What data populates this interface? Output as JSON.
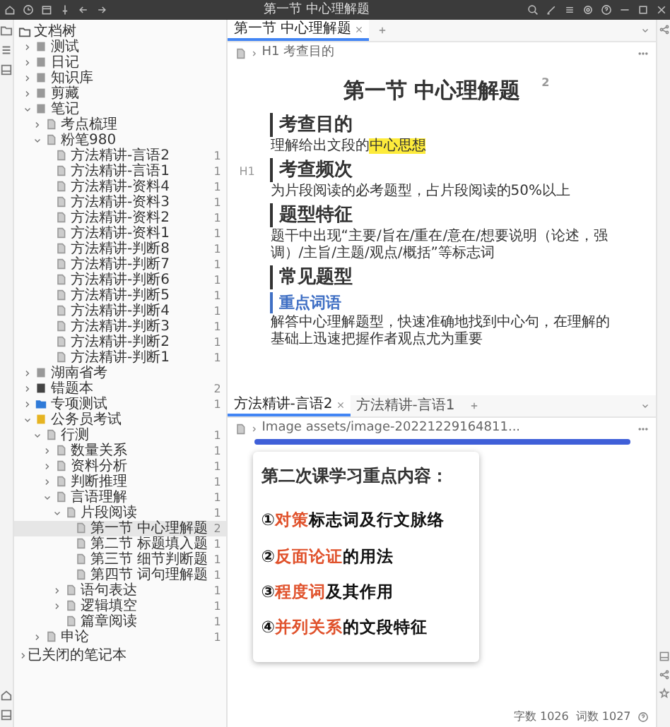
{
  "titlebar": {
    "title": "第一节 中心理解题"
  },
  "filetree": {
    "title": "文档树",
    "items": [
      {
        "name": "测试",
        "kind": "notebook",
        "expanded": false,
        "selected": false
      },
      {
        "name": "日记",
        "kind": "notebook",
        "expanded": false,
        "selected": false
      },
      {
        "name": "知识库",
        "kind": "notebook",
        "expanded": false,
        "selected": false
      },
      {
        "name": "剪藏",
        "kind": "notebook",
        "expanded": false,
        "selected": false
      },
      {
        "name": "笔记",
        "kind": "notebook",
        "expanded": true,
        "selected": false,
        "children": [
          {
            "name": "考点梳理",
            "kind": "doc",
            "expanded": false,
            "selected": false
          },
          {
            "name": "粉笔980",
            "kind": "doc",
            "expanded": true,
            "selected": false,
            "children": [
              {
                "name": "方法精讲-言语2",
                "kind": "doc",
                "count": "1",
                "selected": false
              },
              {
                "name": "方法精讲-言语1",
                "kind": "doc",
                "count": "1",
                "selected": false
              },
              {
                "name": "方法精讲-资料4",
                "kind": "doc",
                "count": "1",
                "selected": false
              },
              {
                "name": "方法精讲-资料3",
                "kind": "doc",
                "count": "1",
                "selected": false
              },
              {
                "name": "方法精讲-资料2",
                "kind": "doc",
                "count": "1",
                "selected": false
              },
              {
                "name": "方法精讲-资料1",
                "kind": "doc",
                "count": "1",
                "selected": false
              },
              {
                "name": "方法精讲-判断8",
                "kind": "doc",
                "count": "1",
                "selected": false
              },
              {
                "name": "方法精讲-判断7",
                "kind": "doc",
                "count": "1",
                "selected": false
              },
              {
                "name": "方法精讲-判断6",
                "kind": "doc",
                "count": "1",
                "selected": false
              },
              {
                "name": "方法精讲-判断5",
                "kind": "doc",
                "count": "1",
                "selected": false
              },
              {
                "name": "方法精讲-判断4",
                "kind": "doc",
                "count": "1",
                "selected": false
              },
              {
                "name": "方法精讲-判断3",
                "kind": "doc",
                "count": "1",
                "selected": false
              },
              {
                "name": "方法精讲-判断2",
                "kind": "doc",
                "count": "1",
                "selected": false
              },
              {
                "name": "方法精讲-判断1",
                "kind": "doc",
                "count": "1",
                "selected": false
              }
            ]
          }
        ]
      },
      {
        "name": "湖南省考",
        "kind": "notebook",
        "expanded": false,
        "selected": false
      },
      {
        "name": "错题本",
        "kind": "book",
        "expanded": false,
        "count": "2",
        "selected": false
      },
      {
        "name": "专项测试",
        "kind": "folder",
        "expanded": false,
        "count": "1",
        "selected": false
      },
      {
        "name": "公务员考试",
        "kind": "journal",
        "expanded": true,
        "selected": false,
        "children": [
          {
            "name": "行测",
            "kind": "doc",
            "expanded": true,
            "count": "1",
            "selected": false,
            "children": [
              {
                "name": "数量关系",
                "kind": "doc",
                "expanded": false,
                "count": "1",
                "selected": false
              },
              {
                "name": "资料分析",
                "kind": "doc",
                "expanded": false,
                "count": "1",
                "selected": false
              },
              {
                "name": "判断推理",
                "kind": "doc",
                "expanded": false,
                "count": "1",
                "selected": false
              },
              {
                "name": "言语理解",
                "kind": "doc",
                "expanded": true,
                "count": "1",
                "selected": false,
                "children": [
                  {
                    "name": "片段阅读",
                    "kind": "doc",
                    "expanded": true,
                    "count": "1",
                    "selected": false,
                    "children": [
                      {
                        "name": "第一节 中心理解题",
                        "kind": "doc",
                        "count": "2",
                        "selected": true
                      },
                      {
                        "name": "第二节 标题填入题",
                        "kind": "doc",
                        "count": "1",
                        "selected": false
                      },
                      {
                        "name": "第三节 细节判断题",
                        "kind": "doc",
                        "count": "1",
                        "selected": false
                      },
                      {
                        "name": "第四节 词句理解题",
                        "kind": "doc",
                        "count": "1",
                        "selected": false
                      }
                    ]
                  },
                  {
                    "name": "语句表达",
                    "kind": "doc",
                    "expanded": false,
                    "count": "1",
                    "selected": false
                  },
                  {
                    "name": "逻辑填空",
                    "kind": "doc",
                    "expanded": false,
                    "count": "1",
                    "selected": false
                  },
                  {
                    "name": "篇章阅读",
                    "kind": "doc",
                    "count": "1",
                    "selected": false
                  }
                ]
              }
            ]
          },
          {
            "name": "申论",
            "kind": "doc",
            "expanded": false,
            "count": "1",
            "selected": false
          }
        ]
      }
    ],
    "closed_notebooks": "已关闭的笔记本"
  },
  "editor": {
    "tabs": [
      {
        "label": "第一节 中心理解题",
        "selected": true
      }
    ],
    "breadcrumb": {
      "tag": "H1",
      "text": "考查目的"
    },
    "doc": {
      "title": "第一节 中心理解题",
      "badge": "2",
      "blocks": [
        {
          "kind": "h1",
          "text": "考查目的"
        },
        {
          "kind": "p",
          "text": "理解给出文段的",
          "highlight": "中心思想"
        },
        {
          "kind": "h1",
          "text": "考查频次",
          "gutter": "H1"
        },
        {
          "kind": "p",
          "text": "为片段阅读的必考题型，占片段阅读的50%以上"
        },
        {
          "kind": "h1",
          "text": "题型特征"
        },
        {
          "kind": "p",
          "text": "题干中出现“主要/旨在/重在/意在/想要说明（论述，强调）/主旨/主题/观点/概括”等标志词"
        },
        {
          "kind": "h1",
          "text": "常见题型"
        },
        {
          "kind": "h2",
          "text": "重点词语"
        },
        {
          "kind": "p",
          "text": "解答中心理解题型，快速准确地找到中心句，在理解的基础上迅速把握作者观点尤为重要"
        }
      ]
    }
  },
  "lower_pane": {
    "tabs": [
      {
        "label": "方法精讲-言语2",
        "selected": true
      },
      {
        "label": "方法精讲-言语1",
        "selected": false
      }
    ],
    "breadcrumb": "Image assets/image-20221229164811...",
    "image": {
      "heading": "第二次课学习重点内容：",
      "lines": [
        {
          "number": "①",
          "highlight": "对策",
          "rest": "标志词及行文脉络"
        },
        {
          "number": "②",
          "highlight": "反面论证",
          "rest": "的用法"
        },
        {
          "number": "③",
          "highlight": "程度词",
          "rest": "及其作用"
        },
        {
          "number": "④",
          "highlight": "并列关系",
          "rest": "的文段特征"
        }
      ]
    }
  },
  "status_bar": {
    "chars": "字数 1026",
    "words": "词数 1027"
  }
}
